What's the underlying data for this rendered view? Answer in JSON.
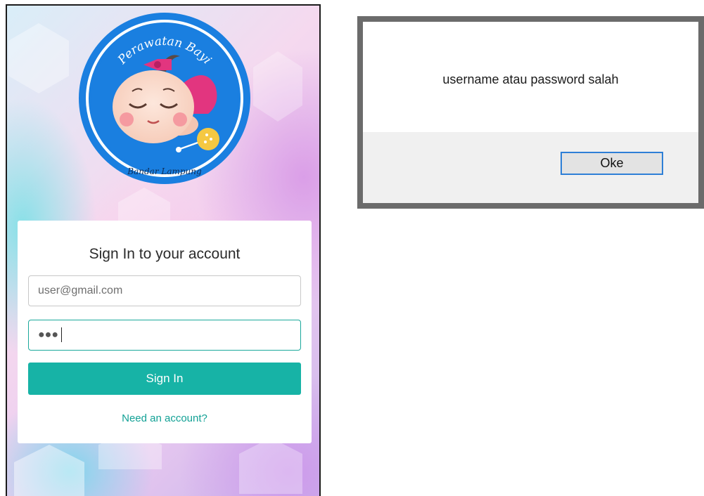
{
  "login": {
    "logo": {
      "top_text": "Perawatan Bayi",
      "bottom_text": "Bandar Lampung"
    },
    "title": "Sign In to your account",
    "email_value": "user@gmail.com",
    "password_masked": "●●●",
    "signin_label": "Sign In",
    "account_link": "Need an account?"
  },
  "dialog": {
    "message": "username atau password salah",
    "ok_label": "Oke"
  },
  "colors": {
    "accent": "#17b3a6",
    "logo_blue": "#1a7fe0",
    "dialog_border": "#6b6b6b",
    "ok_border": "#2e7fd6"
  },
  "icons": [
    "baby-logo-icon"
  ]
}
